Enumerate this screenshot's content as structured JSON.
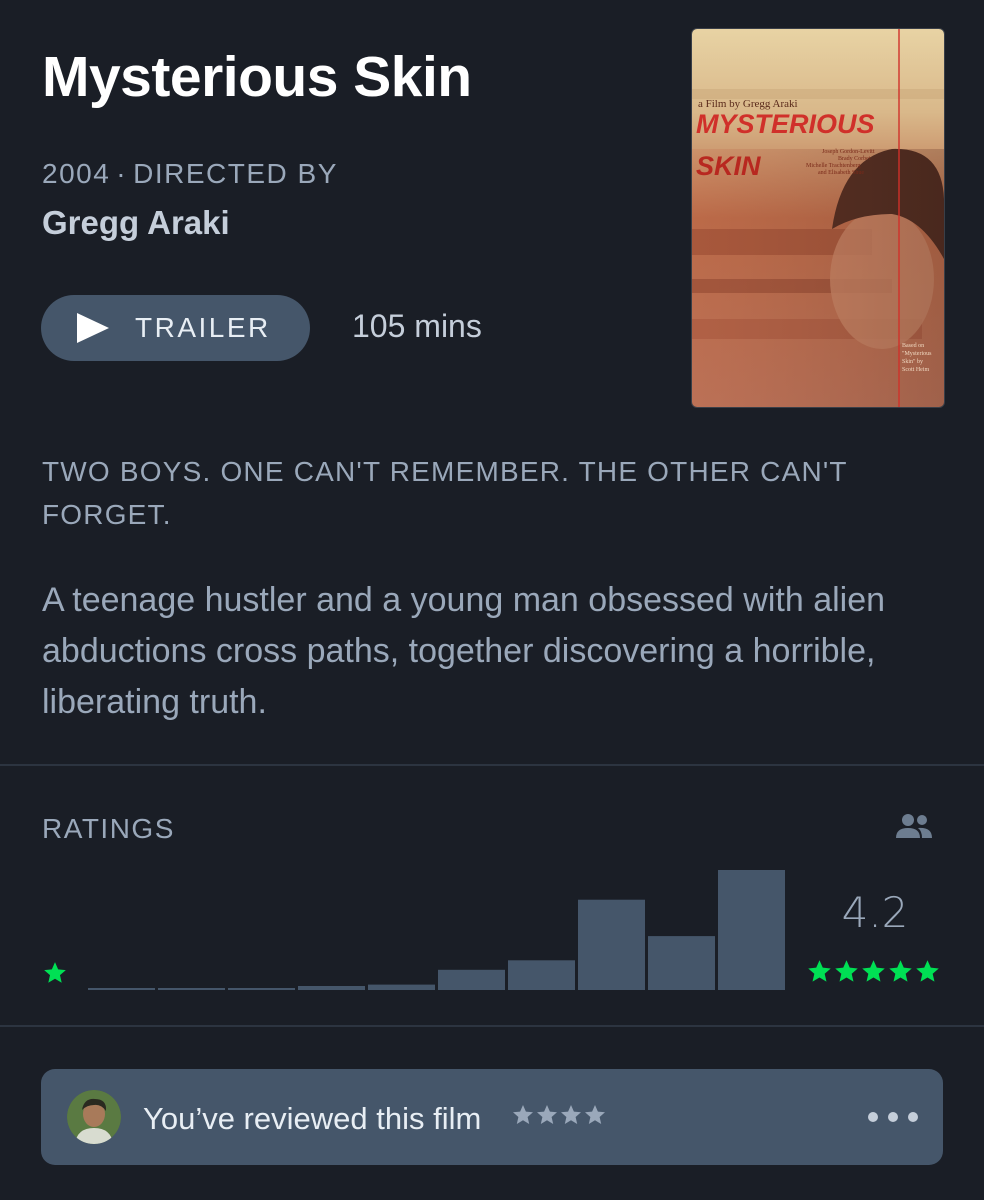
{
  "film": {
    "title": "Mysterious Skin",
    "year": "2004",
    "separator": "·",
    "directed_by_label": "DIRECTED BY",
    "director": "Gregg Araki",
    "trailer_label": "TRAILER",
    "runtime": "105 mins",
    "tagline": "TWO BOYS. ONE CAN'T REMEMBER. THE OTHER CAN'T FORGET.",
    "synopsis": "A teenage hustler and a young man obsessed with alien abductions cross paths, together discovering a horrible, liberating truth."
  },
  "poster": {
    "credit": "a Film by Gregg Araki",
    "title_line1": "MYSTERIOUS",
    "title_line2": "SKIN",
    "cast": [
      "Joseph Gordon-Levitt",
      "Brady Corbet",
      "Michelle Trachtenberg",
      "and Elisabeth Shue"
    ],
    "based_on": [
      "Based on",
      "\"Mysterious",
      "Skin\" by",
      "Scott Heim"
    ]
  },
  "ratings": {
    "label": "RATINGS",
    "average": "4.2",
    "min_star_count": 1,
    "max_star_count": 5,
    "icons": {
      "fans": "people-icon",
      "low": "star-icon",
      "high": "five-star-icon"
    },
    "colors": {
      "bar": "#45566a",
      "star": "#00e054"
    }
  },
  "chart_data": {
    "type": "bar",
    "categories": [
      "0.5",
      "1",
      "1.5",
      "2",
      "2.5",
      "3",
      "3.5",
      "4",
      "4.5",
      "5"
    ],
    "values": [
      1,
      1,
      1,
      3,
      4,
      15,
      22,
      67,
      40,
      89
    ],
    "ylim": [
      0,
      89
    ]
  },
  "review": {
    "text": "You’ve reviewed this film",
    "rating_stars": 4,
    "avatar_icon": "avatar",
    "menu_icon": "more-icon"
  }
}
